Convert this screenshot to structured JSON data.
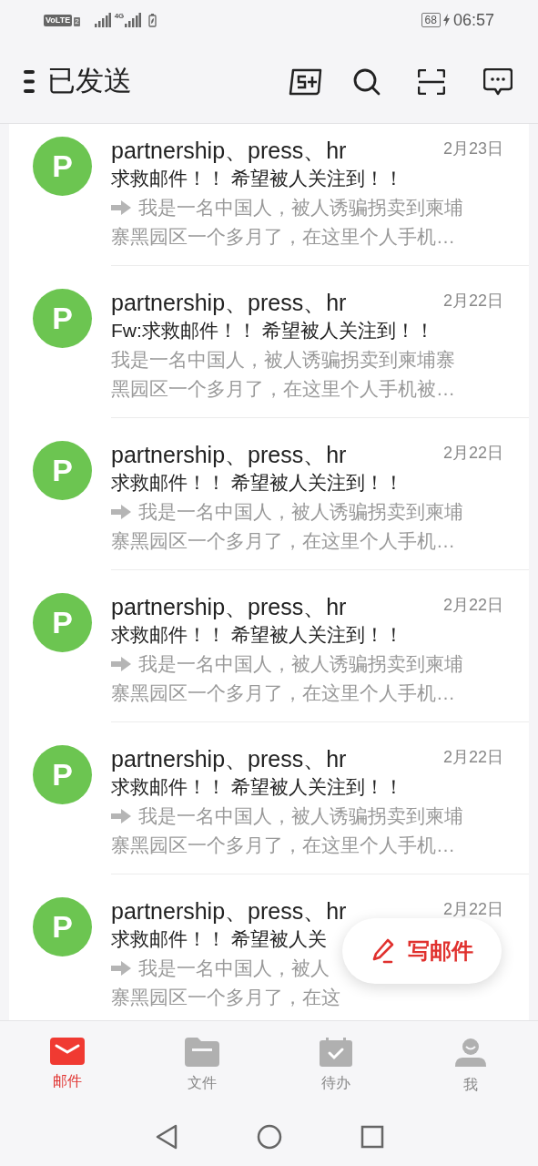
{
  "status_bar": {
    "volte": "VoLTE",
    "sim": "2",
    "network": "4G",
    "battery": "68",
    "time": "06:57"
  },
  "header": {
    "title": "已发送"
  },
  "emails": [
    {
      "sender": "partnership、press、hr",
      "date": "2月23日",
      "subject": "求救邮件！！ 希望被人关注到！！",
      "forwarded": true,
      "preview_lines": [
        "我是一名中国人，被人诱骗拐卖到柬埔",
        "寨黑园区一个多月了，在这里个人手机…"
      ],
      "avatar": "P"
    },
    {
      "sender": "partnership、press、hr",
      "date": "2月22日",
      "subject": "Fw:求救邮件！！ 希望被人关注到！！",
      "forwarded": false,
      "preview_lines": [
        "我是一名中国人，被人诱骗拐卖到柬埔寨",
        "黑园区一个多月了，在这里个人手机被…"
      ],
      "avatar": "P"
    },
    {
      "sender": "partnership、press、hr",
      "date": "2月22日",
      "subject": "求救邮件！！ 希望被人关注到！！",
      "forwarded": true,
      "preview_lines": [
        "我是一名中国人，被人诱骗拐卖到柬埔",
        "寨黑园区一个多月了，在这里个人手机…"
      ],
      "avatar": "P"
    },
    {
      "sender": "partnership、press、hr",
      "date": "2月22日",
      "subject": "求救邮件！！ 希望被人关注到！！",
      "forwarded": true,
      "preview_lines": [
        "我是一名中国人，被人诱骗拐卖到柬埔",
        "寨黑园区一个多月了，在这里个人手机…"
      ],
      "avatar": "P"
    },
    {
      "sender": "partnership、press、hr",
      "date": "2月22日",
      "subject": "求救邮件！！ 希望被人关注到！！",
      "forwarded": true,
      "preview_lines": [
        "我是一名中国人，被人诱骗拐卖到柬埔",
        "寨黑园区一个多月了，在这里个人手机…"
      ],
      "avatar": "P"
    },
    {
      "sender": "partnership、press、hr",
      "date": "2月22日",
      "subject": "求救邮件！！ 希望被人关",
      "forwarded": true,
      "preview_lines": [
        "我是一名中国人，被人",
        "寨黑园区一个多月了，在这"
      ],
      "avatar": "P"
    }
  ],
  "compose_button": {
    "label": "写邮件"
  },
  "tabs": [
    {
      "label": "邮件",
      "kind": "mail",
      "selected": true
    },
    {
      "label": "文件",
      "kind": "folder",
      "selected": false
    },
    {
      "label": "待办",
      "kind": "todo",
      "selected": false
    },
    {
      "label": "我",
      "kind": "me",
      "selected": false
    }
  ]
}
